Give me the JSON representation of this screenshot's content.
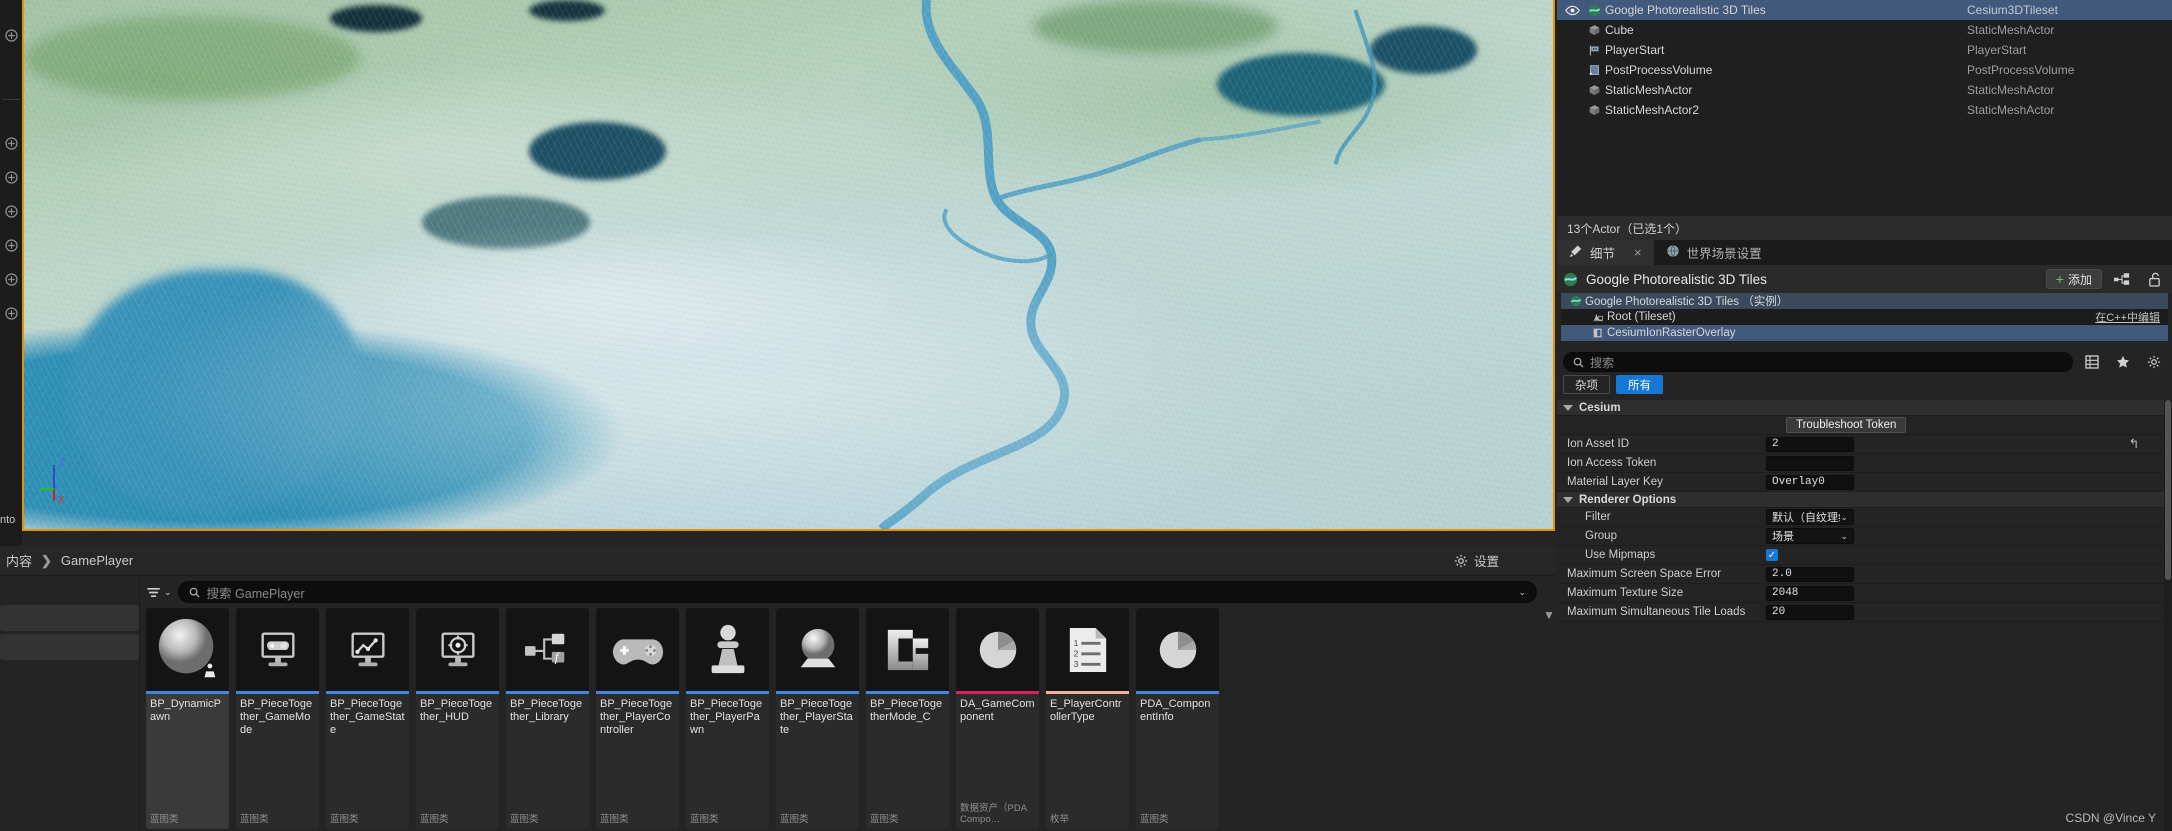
{
  "outliner": {
    "rows": [
      {
        "label": "Google Photorealistic 3D Tiles",
        "type": "Cesium3DTileset",
        "icon": "cesium-icon",
        "selected": true,
        "visible": true
      },
      {
        "label": "Cube",
        "type": "StaticMeshActor",
        "icon": "mesh-icon",
        "selected": false,
        "visible": false
      },
      {
        "label": "PlayerStart",
        "type": "PlayerStart",
        "icon": "playerstart-icon",
        "selected": false,
        "visible": false
      },
      {
        "label": "PostProcessVolume",
        "type": "PostProcessVolume",
        "icon": "volume-icon",
        "selected": false,
        "visible": false
      },
      {
        "label": "StaticMeshActor",
        "type": "StaticMeshActor",
        "icon": "mesh-icon",
        "selected": false,
        "visible": false
      },
      {
        "label": "StaticMeshActor2",
        "type": "StaticMeshActor",
        "icon": "mesh-icon",
        "selected": false,
        "visible": false
      }
    ],
    "status": "13个Actor（已选1个）"
  },
  "details": {
    "tabs": [
      {
        "label": "细节",
        "icon": "details-pencil-icon",
        "active": true,
        "closable": true
      },
      {
        "label": "世界场景设置",
        "icon": "globe-icon",
        "active": false,
        "closable": false
      }
    ],
    "close_glyph": "×",
    "header": {
      "title": "Google Photorealistic 3D Tiles",
      "add_label": "添加",
      "add_plus": "+",
      "blueprint_icon": "blueprint-icon",
      "lock_icon": "unlock-icon"
    },
    "components": [
      {
        "label": "Google Photorealistic 3D Tiles （实例）",
        "indent": 0,
        "kind": "root",
        "icon": "cesium-icon",
        "right": ""
      },
      {
        "label": "Root (Tileset)",
        "indent": 1,
        "kind": "child",
        "icon": "tileset-icon",
        "right": "在C++中编辑"
      },
      {
        "label": "CesiumIonRasterOverlay",
        "indent": 1,
        "kind": "selected",
        "icon": "overlay-icon",
        "right": ""
      }
    ],
    "search_placeholder": "搜索",
    "toolbar_icons": [
      "grid-view-icon",
      "favorite-star-icon",
      "settings-gear-icon"
    ],
    "filter_pills": [
      {
        "label": "杂项",
        "active": false
      },
      {
        "label": "所有",
        "active": true
      }
    ],
    "sections": [
      {
        "name": "Cesium",
        "rows": [
          {
            "kind": "button",
            "label": "",
            "value": "Troubleshoot Token"
          },
          {
            "kind": "text",
            "label": "Ion Asset ID",
            "value": "2",
            "reset": "↰"
          },
          {
            "kind": "text",
            "label": "Ion Access Token",
            "value": "",
            "reset": ""
          },
          {
            "kind": "text",
            "label": "Material Layer Key",
            "value": "Overlay0",
            "reset": ""
          }
        ]
      },
      {
        "name": "Renderer Options",
        "rows": [
          {
            "kind": "combo",
            "label": "Filter",
            "value": "默认（自纹理组）",
            "indent": true
          },
          {
            "kind": "combo",
            "label": "Group",
            "value": "场景",
            "indent": true
          },
          {
            "kind": "check",
            "label": "Use Mipmaps",
            "value": "✓",
            "indent": true,
            "checked": true
          },
          {
            "kind": "text",
            "label": "Maximum Screen Space Error",
            "value": "2.0"
          },
          {
            "kind": "text",
            "label": "Maximum Texture Size",
            "value": "2048"
          },
          {
            "kind": "text",
            "label": "Maximum Simultaneous Tile Loads",
            "value": "20"
          }
        ]
      }
    ],
    "annotation": {
      "shape": "red-ellipse",
      "color": "#e11b1b"
    }
  },
  "content_browser": {
    "breadcrumb": {
      "root": "内容",
      "sep": "❯",
      "current": "GamePlayer"
    },
    "settings_label": "设置",
    "settings_icon": "gear-icon",
    "search_placeholder": "搜索 GamePlayer",
    "filter_icon": "filter-icon",
    "assets": [
      {
        "name": "BP_DynamicPawn",
        "type": "蓝图类",
        "accent": "blue",
        "thumb": "sphere-pawn-icon",
        "selected": true
      },
      {
        "name": "BP_PieceTogether_GameMode",
        "type": "蓝图类",
        "accent": "blue",
        "thumb": "gamemode-monitor-icon",
        "selected": false
      },
      {
        "name": "BP_PieceTogether_GameState",
        "type": "蓝图类",
        "accent": "blue",
        "thumb": "gamestate-monitor-icon",
        "selected": false
      },
      {
        "name": "BP_PieceTogether_HUD",
        "type": "蓝图类",
        "accent": "blue",
        "thumb": "hud-monitor-icon",
        "selected": false
      },
      {
        "name": "BP_PieceTogether_Library",
        "type": "蓝图类",
        "accent": "blue",
        "thumb": "function-library-icon",
        "selected": false
      },
      {
        "name": "BP_PieceTogether_PlayerController",
        "type": "蓝图类",
        "accent": "blue",
        "thumb": "gamepad-icon",
        "selected": false
      },
      {
        "name": "BP_PieceTogether_PlayerPawn",
        "type": "蓝图类",
        "accent": "blue",
        "thumb": "pawn-icon",
        "selected": false
      },
      {
        "name": "BP_PieceTogether_PlayerState",
        "type": "蓝图类",
        "accent": "blue",
        "thumb": "playerstate-icon",
        "selected": false
      },
      {
        "name": "BP_PieceTogetherMode_C",
        "type": "蓝图类",
        "accent": "blue",
        "thumb": "blueprint-c-icon",
        "selected": false
      },
      {
        "name": "DA_GameComponent",
        "type": "数据资产（PDA Compo…",
        "accent": "red",
        "thumb": "pie-chart-icon",
        "selected": false
      },
      {
        "name": "E_PlayerControllerType",
        "type": "枚举",
        "accent": "peach",
        "thumb": "enum-list-icon",
        "selected": false
      },
      {
        "name": "PDA_ComponentInfo",
        "type": "蓝图类",
        "accent": "blue",
        "thumb": "pie-chart-icon",
        "selected": false
      }
    ],
    "scroll_arrow": "▼"
  },
  "viewport": {
    "axis": {
      "z": "Z",
      "x": "X",
      "y": "Y"
    },
    "corner_text": "nto",
    "left_toolbar_icons": [
      "select-mode-icon",
      "translate-icon",
      "rotate-icon",
      "scale-icon",
      "snap-icon",
      "camera-speed-icon",
      "grid-icon"
    ]
  },
  "watermark": "CSDN @Vince Y"
}
